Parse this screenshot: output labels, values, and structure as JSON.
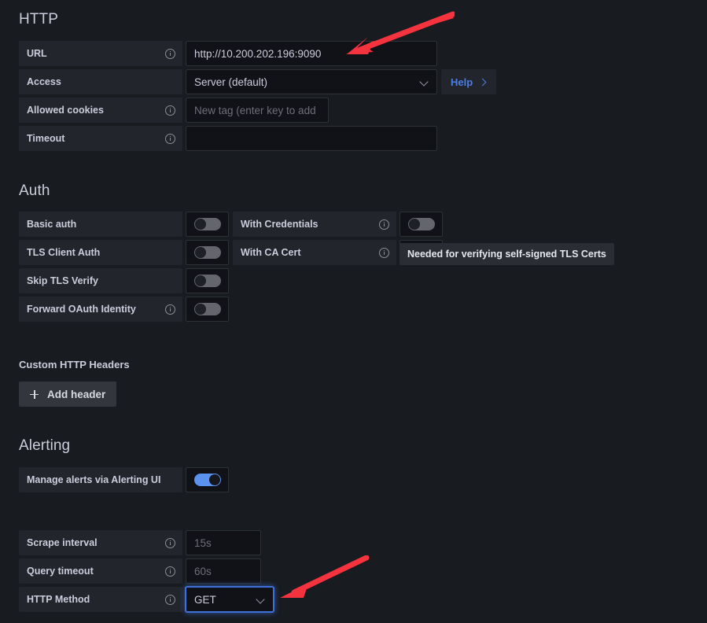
{
  "sections": {
    "http": {
      "title": "HTTP",
      "rows": [
        {
          "label": "URL",
          "has_info": true,
          "value": "http://10.200.202.196:9090",
          "is_placeholder": false
        },
        {
          "label": "Access",
          "has_info": false,
          "value": "Server (default)",
          "is_placeholder": false
        },
        {
          "label": "Allowed cookies",
          "has_info": true,
          "value": "New tag (enter key to add",
          "is_placeholder": true
        },
        {
          "label": "Timeout",
          "has_info": true,
          "value": "",
          "is_placeholder": false
        }
      ],
      "help_label": "Help"
    },
    "auth": {
      "title": "Auth",
      "left_rows": [
        {
          "label": "Basic auth",
          "has_info": false,
          "enabled": false
        },
        {
          "label": "TLS Client Auth",
          "has_info": false,
          "enabled": false
        },
        {
          "label": "Skip TLS Verify",
          "has_info": false,
          "enabled": false
        },
        {
          "label": "Forward OAuth Identity",
          "has_info": true,
          "enabled": false
        }
      ],
      "right_rows": [
        {
          "label": "With Credentials",
          "has_info": true,
          "enabled": false
        },
        {
          "label": "With CA Cert",
          "has_info": true,
          "enabled": false
        }
      ],
      "tooltip": "Needed for verifying self-signed TLS Certs"
    },
    "custom_headers": {
      "title": "Custom HTTP Headers",
      "add_header_label": "Add header"
    },
    "alerting": {
      "title": "Alerting",
      "rows": [
        {
          "label": "Manage alerts via Alerting UI",
          "has_info": false,
          "enabled": true
        }
      ]
    },
    "misc": {
      "rows": [
        {
          "label": "Scrape interval",
          "has_info": true,
          "value": "15s",
          "is_placeholder": true,
          "is_select": false,
          "focused": false
        },
        {
          "label": "Query timeout",
          "has_info": true,
          "value": "60s",
          "is_placeholder": true,
          "is_select": false,
          "focused": false
        },
        {
          "label": "HTTP Method",
          "has_info": true,
          "value": "GET",
          "is_placeholder": false,
          "is_select": true,
          "focused": true
        }
      ]
    }
  },
  "annotations": {
    "arrow_color": "#f5333f",
    "arrows": [
      {
        "name": "arrow-to-url-field",
        "points_to": "URL"
      },
      {
        "name": "arrow-to-http-method-field",
        "points_to": "HTTP Method"
      }
    ]
  },
  "theme": {
    "background": "#181b1f",
    "label_background": "#22252b",
    "input_background": "#111217",
    "accent_blue": "#3d71d9",
    "link_blue": "#4a7ee8",
    "toggle_on": "#5b92f0"
  }
}
